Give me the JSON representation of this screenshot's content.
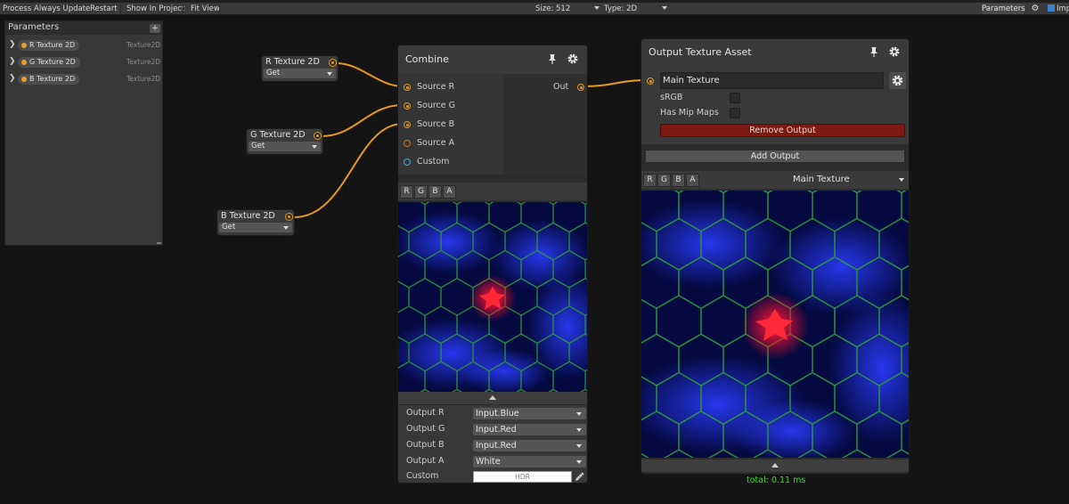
{
  "toolbar": {
    "process": "Process",
    "always_update": "Always Update",
    "restart": "Restart",
    "show_in_project": "Show In Project",
    "fit_view": "Fit View",
    "size": "Size: 512",
    "type": "Type: 2D",
    "parameters": "Parameters",
    "imp": "Imp"
  },
  "parameters_panel": {
    "title": "Parameters",
    "add": "+",
    "items": [
      {
        "name": "R Texture 2D",
        "type": "Texture2D"
      },
      {
        "name": "G Texture 2D",
        "type": "Texture2D"
      },
      {
        "name": "B Texture 2D",
        "type": "Texture2D"
      }
    ]
  },
  "param_nodes": [
    {
      "title": "R Texture 2D",
      "mode": "Get"
    },
    {
      "title": "G Texture 2D",
      "mode": "Get"
    },
    {
      "title": "B Texture 2D",
      "mode": "Get"
    }
  ],
  "combine_node": {
    "title": "Combine",
    "inputs": [
      "Source R",
      "Source G",
      "Source B",
      "Source A",
      "Custom"
    ],
    "output": "Out",
    "channels": [
      "R",
      "G",
      "B",
      "A"
    ],
    "fields": [
      {
        "label": "Output R",
        "value": "Input.Blue"
      },
      {
        "label": "Output G",
        "value": "Input.Red"
      },
      {
        "label": "Output B",
        "value": "Input.Red"
      },
      {
        "label": "Output A",
        "value": "White"
      }
    ],
    "custom_label": "Custom",
    "custom_value": "HDR"
  },
  "output_node": {
    "title": "Output Texture Asset",
    "texture_name": "Main Texture",
    "srgb_label": "sRGB",
    "mipmaps_label": "Has Mip Maps",
    "remove_button": "Remove Output",
    "add_button": "Add Output",
    "channels": [
      "R",
      "G",
      "B",
      "A"
    ],
    "selected_texture": "Main Texture"
  },
  "status": {
    "timing": "total: 0.11 ms"
  },
  "colors": {
    "edge": "#e8981f",
    "timing": "#3bdc2e",
    "remove": "#7a1a10"
  }
}
